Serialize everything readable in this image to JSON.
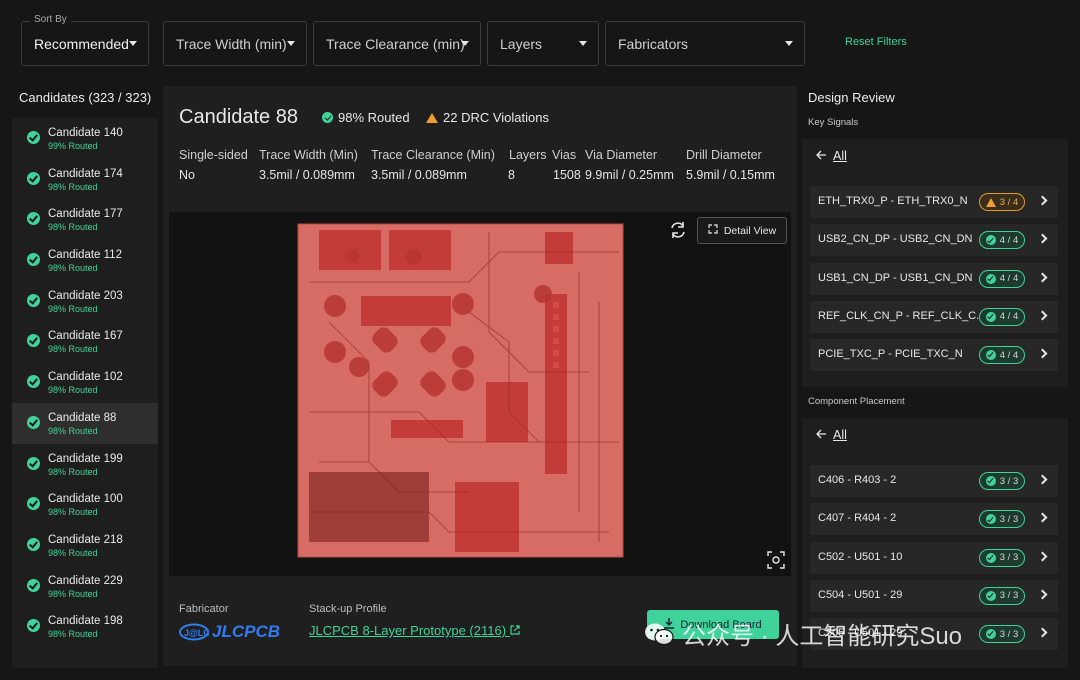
{
  "filters": {
    "sort_legend": "Sort By",
    "sort_value": "Recommended",
    "trace_width": "Trace Width (min)",
    "trace_clearance": "Trace Clearance (min)",
    "layers": "Layers",
    "fabricators": "Fabricators",
    "reset": "Reset Filters"
  },
  "candidates": {
    "header": "Candidates (323 / 323)",
    "items": [
      {
        "name": "Candidate 140",
        "pct": "99% Routed"
      },
      {
        "name": "Candidate 174",
        "pct": "98% Routed"
      },
      {
        "name": "Candidate 177",
        "pct": "98% Routed"
      },
      {
        "name": "Candidate 112",
        "pct": "98% Routed"
      },
      {
        "name": "Candidate 203",
        "pct": "98% Routed"
      },
      {
        "name": "Candidate 167",
        "pct": "98% Routed"
      },
      {
        "name": "Candidate 102",
        "pct": "98% Routed"
      },
      {
        "name": "Candidate 88",
        "pct": "98% Routed"
      },
      {
        "name": "Candidate 199",
        "pct": "98% Routed"
      },
      {
        "name": "Candidate 100",
        "pct": "98% Routed"
      },
      {
        "name": "Candidate 218",
        "pct": "98% Routed"
      },
      {
        "name": "Candidate 229",
        "pct": "98% Routed"
      },
      {
        "name": "Candidate 198",
        "pct": "98% Routed"
      }
    ],
    "active_index": 7
  },
  "detail": {
    "title": "Candidate 88",
    "routed": "98% Routed",
    "drc": "22 DRC Violations",
    "specs_header": {
      "single_sided": "Single-sided",
      "trace_width": "Trace Width (Min)",
      "trace_clearance": "Trace Clearance (Min)",
      "layers": "Layers",
      "vias": "Vias",
      "via_diameter": "Via Diameter",
      "drill_diameter": "Drill Diameter"
    },
    "specs_values": {
      "single_sided": "No",
      "trace_width": "3.5mil / 0.089mm",
      "trace_clearance": "3.5mil / 0.089mm",
      "layers": "8",
      "vias": "1508",
      "via_diameter": "9.9mil / 0.25mm",
      "drill_diameter": "5.9mil / 0.15mm"
    },
    "detail_view": "Detail View",
    "fabricator_label": "Fabricator",
    "fabricator_logo": "JLCPCB",
    "stackup_label": "Stack-up Profile",
    "stackup_link": "JLCPCB 8-Layer Prototype (2116)",
    "download": "Download Board"
  },
  "review": {
    "title": "Design Review",
    "key_signals_label": "Key Signals",
    "all_label": "All",
    "signals": [
      {
        "name": "ETH_TRX0_P - ETH_TRX0_N",
        "count": "3 / 4",
        "status": "warning"
      },
      {
        "name": "USB2_CN_DP - USB2_CN_DN",
        "count": "4 / 4",
        "status": "ok"
      },
      {
        "name": "USB1_CN_DP - USB1_CN_DN",
        "count": "4 / 4",
        "status": "ok"
      },
      {
        "name": "REF_CLK_CN_P - REF_CLK_C...",
        "count": "4 / 4",
        "status": "ok"
      },
      {
        "name": "PCIE_TXC_P - PCIE_TXC_N",
        "count": "4 / 4",
        "status": "ok"
      }
    ],
    "placement_label": "Component Placement",
    "placements": [
      {
        "name": "C406 - R403 - 2",
        "count": "3 / 3",
        "status": "ok"
      },
      {
        "name": "C407 - R404 - 2",
        "count": "3 / 3",
        "status": "ok"
      },
      {
        "name": "C502 - U501 - 10",
        "count": "3 / 3",
        "status": "ok"
      },
      {
        "name": "C504 - U501 - 29",
        "count": "3 / 3",
        "status": "ok"
      },
      {
        "name": "C505 - U501 - 29",
        "count": "3 / 3",
        "status": "ok"
      }
    ]
  },
  "colors": {
    "accent": "#3fd39b",
    "warning": "#f0a030",
    "board": "#e7746a"
  },
  "watermark": "公众号 · 人工智能研究Suo"
}
